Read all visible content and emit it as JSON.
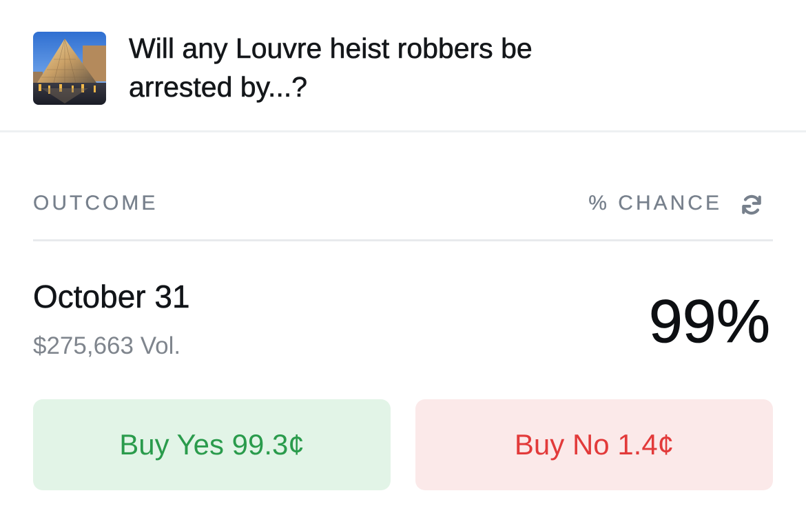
{
  "market": {
    "title": "Will any Louvre heist robbers be arrested by...?",
    "thumbnail": "louvre-pyramid-image"
  },
  "table": {
    "outcome_header": "OUTCOME",
    "chance_header": "% CHANCE",
    "refresh_icon": "refresh-icon"
  },
  "outcome": {
    "name": "October 31",
    "volume": "$275,663 Vol.",
    "chance": "99%"
  },
  "actions": {
    "buy_yes": "Buy Yes 99.3¢",
    "buy_no": "Buy No 1.4¢"
  },
  "colors": {
    "yes_bg": "#e2f4e7",
    "yes_text": "#2a9b4c",
    "no_bg": "#fbe9e9",
    "no_text": "#e23a3a",
    "muted": "#77808c"
  }
}
